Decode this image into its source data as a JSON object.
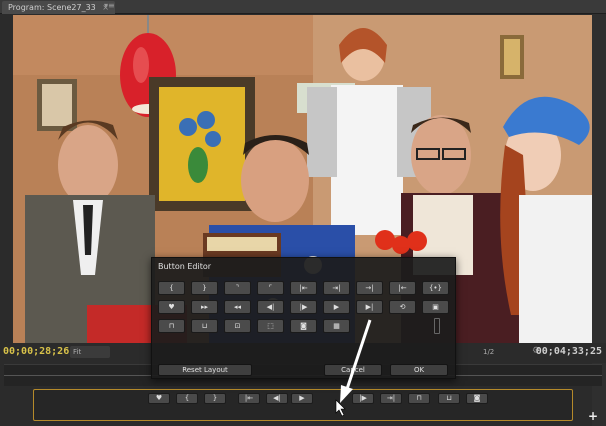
{
  "panel": {
    "tab_title": "Program: Scene27_33",
    "tab_close": "×",
    "tab_menu": "▾≡"
  },
  "monitor": {
    "timecode_in": "00;00;28;26",
    "fit_label": "Fit",
    "ratio_label": "1/2",
    "timecode_duration": "00;04;33;25"
  },
  "dialog": {
    "title": "Button Editor",
    "grid_icons": [
      "mark-in",
      "mark-out",
      "mark-clip-in",
      "mark-clip-out",
      "go-to-in",
      "go-to-out",
      "go-to-next-edit",
      "go-to-prev-edit",
      "clear-in-out",
      "add-marker",
      "shuttle-right",
      "shuttle-left",
      "step-back",
      "step-forward",
      "play",
      "play-in-to-out",
      "loop",
      "safe-margins",
      "lift",
      "extract",
      "overwrite",
      "export-frame",
      "camera",
      "multi-camera"
    ],
    "grid_glyphs": [
      "{",
      "}",
      "⌝",
      "⌜",
      "|⇤",
      "⇥|",
      "→|",
      "|←",
      "{•}",
      "♥",
      "▸▸",
      "◂◂",
      "◀|",
      "|▶",
      "▶",
      "▶|",
      "⟲",
      "▣",
      "⊓",
      "⊔",
      "⊡",
      "⬚",
      "◙",
      "▦"
    ],
    "reset_label": "Reset Layout",
    "cancel_label": "Cancel",
    "ok_label": "OK"
  },
  "transport": {
    "glyphs": [
      "♥",
      "{",
      "}",
      "|⇤",
      "◀|",
      "▶",
      "|▶",
      "⇥|",
      "⊓",
      "⊔",
      "◙"
    ],
    "icons": [
      "add-marker",
      "mark-in",
      "mark-out",
      "go-to-in",
      "step-back",
      "play",
      "step-forward",
      "go-to-out",
      "lift",
      "extract",
      "export-frame"
    ]
  },
  "colors": {
    "timecode_accent": "#d8c24a",
    "transport_border": "#b58a2a"
  }
}
